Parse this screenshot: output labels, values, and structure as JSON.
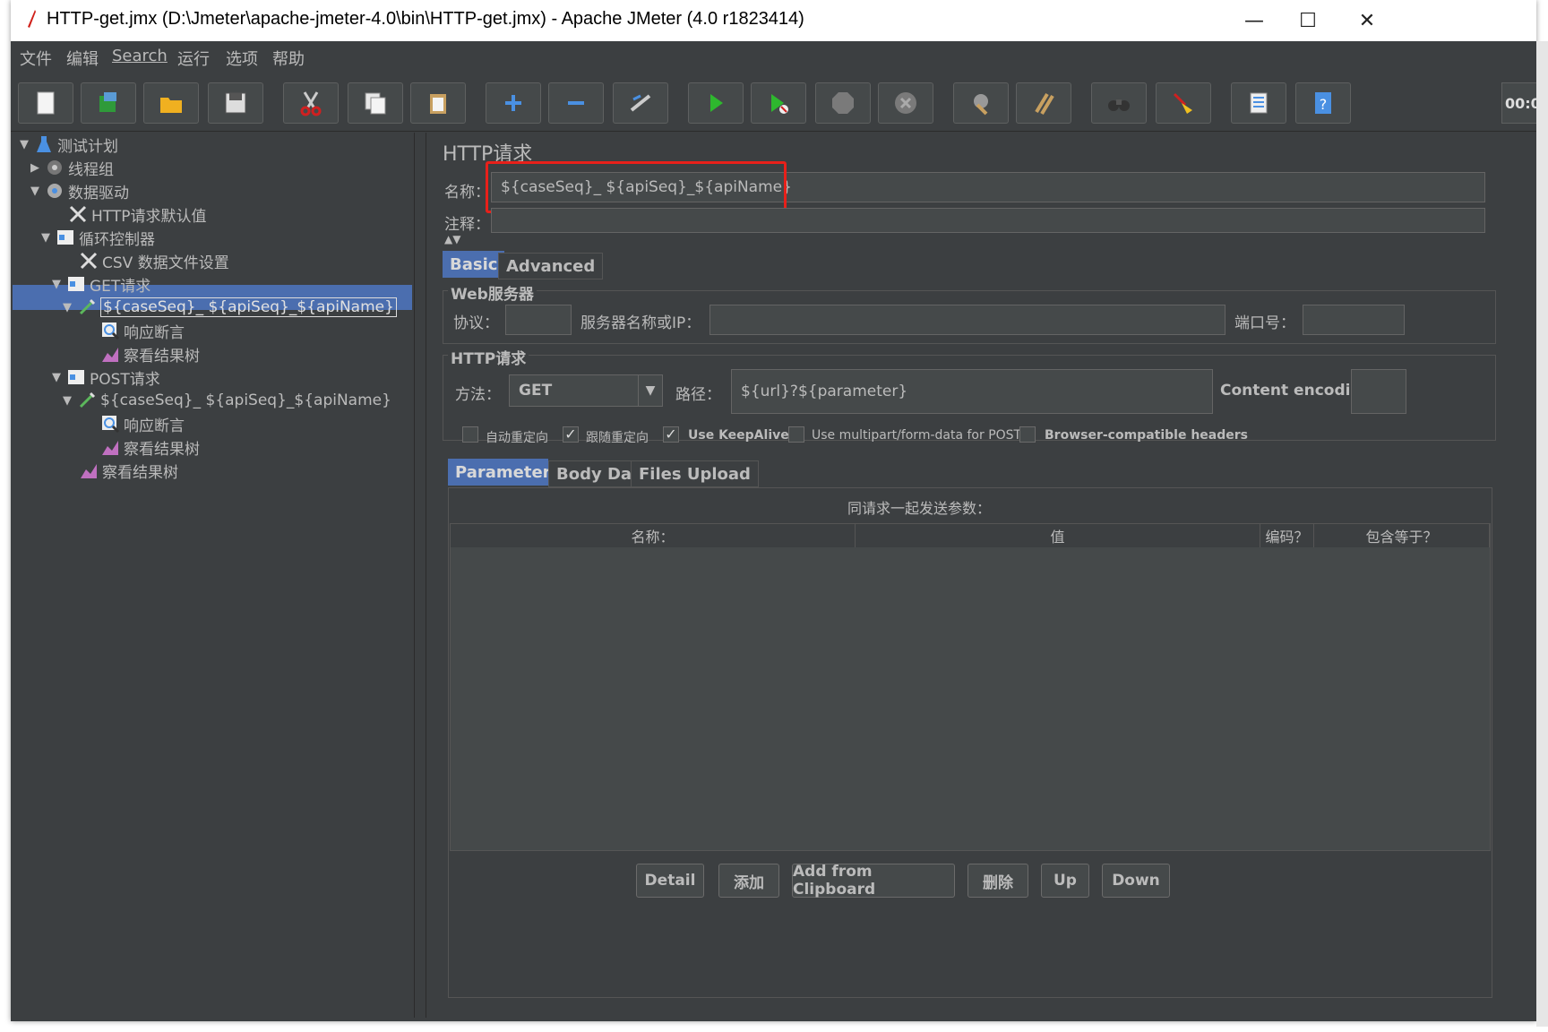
{
  "window": {
    "title": "HTTP-get.jmx (D:\\Jmeter\\apache-jmeter-4.0\\bin\\HTTP-get.jmx) - Apache JMeter (4.0 r1823414)",
    "minimize": "—",
    "maximize": "☐",
    "close": "✕"
  },
  "menu": {
    "items": [
      "文件",
      "编辑",
      "Search",
      "运行",
      "选项",
      "帮助"
    ]
  },
  "toolbar": {
    "timer": "00:0"
  },
  "tree": {
    "items": [
      {
        "label": "测试计划",
        "arrow": "▼",
        "icon": "flask-icon"
      },
      {
        "label": "线程组",
        "arrow": "▶",
        "icon": "gear-icon"
      },
      {
        "label": "数据驱动",
        "arrow": "▼",
        "icon": "gear-icon"
      },
      {
        "label": "HTTP请求默认值",
        "arrow": "",
        "icon": "wrench-icon"
      },
      {
        "label": "循环控制器",
        "arrow": "▼",
        "icon": "controller-icon"
      },
      {
        "label": "CSV 数据文件设置",
        "arrow": "",
        "icon": "wrench-icon"
      },
      {
        "label": "GET请求",
        "arrow": "▼",
        "icon": "controller-icon"
      },
      {
        "label": "${caseSeq}_ ${apiSeq}_${apiName}",
        "arrow": "▼",
        "icon": "pipette-icon"
      },
      {
        "label": "响应断言",
        "arrow": "",
        "icon": "magnifier-icon"
      },
      {
        "label": "察看结果树",
        "arrow": "",
        "icon": "chart-icon"
      },
      {
        "label": "POST请求",
        "arrow": "▼",
        "icon": "controller-icon"
      },
      {
        "label": "${caseSeq}_ ${apiSeq}_${apiName}",
        "arrow": "▼",
        "icon": "pipette-icon"
      },
      {
        "label": "响应断言",
        "arrow": "",
        "icon": "magnifier-icon"
      },
      {
        "label": "察看结果树",
        "arrow": "",
        "icon": "chart-icon"
      },
      {
        "label": "察看结果树",
        "arrow": "",
        "icon": "chart-icon"
      }
    ]
  },
  "panel": {
    "title": "HTTP请求",
    "name_label": "名称：",
    "name_value": "${caseSeq}_ ${apiSeq}_${apiName}",
    "comment_label": "注释：",
    "comment_value": "",
    "tabs": [
      "Basic",
      "Advanced"
    ],
    "web_server": {
      "title": "Web服务器",
      "protocol_label": "协议：",
      "protocol_value": "",
      "server_label": "服务器名称或IP：",
      "server_value": "",
      "port_label": "端口号：",
      "port_value": ""
    },
    "http_request": {
      "title": "HTTP请求",
      "method_label": "方法：",
      "method_value": "GET",
      "path_label": "路径：",
      "path_value": "${url}?${parameter}",
      "encoding_label": "Content encoding:",
      "encoding_value": ""
    },
    "checkboxes": [
      {
        "label": "自动重定向",
        "checked": false
      },
      {
        "label": "跟随重定向",
        "checked": true
      },
      {
        "label": "Use KeepAlive",
        "checked": true
      },
      {
        "label": "Use multipart/form-data for POST",
        "checked": false
      },
      {
        "label": "Browser-compatible headers",
        "checked": false
      }
    ],
    "param_tabs": [
      "Parameters",
      "Body Data",
      "Files Upload"
    ],
    "params_caption": "同请求一起发送参数：",
    "columns": [
      "名称：",
      "值",
      "编码？",
      "包含等于？"
    ],
    "buttons": [
      "Detail",
      "添加",
      "Add from Clipboard",
      "删除",
      "Up",
      "Down"
    ]
  },
  "colors": {
    "background": "#3c3f41",
    "selection": "#4b6eaf",
    "highlight_box": "#e8201a"
  }
}
